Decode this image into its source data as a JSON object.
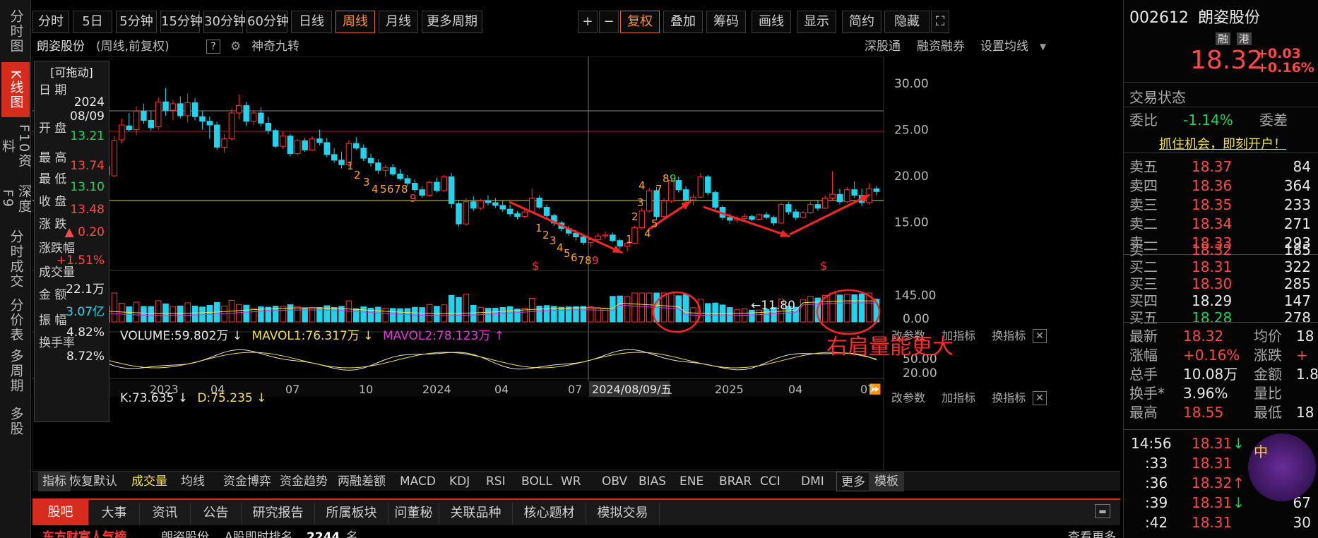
{
  "left_nav": [
    "分时图",
    "K线图",
    "F10资料",
    "深度F9",
    "分时成交",
    "分价表",
    "多周期",
    "多股"
  ],
  "left_nav_active": 1,
  "toolbar": {
    "periods": [
      "分时",
      "5日",
      "5分钟",
      "15分钟",
      "30分钟",
      "60分钟",
      "日线",
      "周线",
      "月线",
      "更多周期"
    ],
    "selected_period": "周线",
    "right_buttons": [
      "+",
      "−",
      "复权",
      "叠加",
      "筹码",
      "画线",
      "显示",
      "简约",
      "隐藏"
    ]
  },
  "chart_header": {
    "name": "朗姿股份",
    "desc": "(周线,前复权)",
    "help": "?",
    "magic": "神奇九转",
    "links": [
      "深股通",
      "融资融券",
      "设置均线"
    ]
  },
  "data_window": {
    "drag_label": "[可拖动]",
    "rows": [
      {
        "label": "日 期",
        "value": "2024\n08/09",
        "color": "white"
      },
      {
        "label": "开 盘",
        "value": "13.21",
        "color": "green"
      },
      {
        "label": "最 高",
        "value": "13.74",
        "color": "red"
      },
      {
        "label": "最 低",
        "value": "13.10",
        "color": "green"
      },
      {
        "label": "收 盘",
        "value": "13.48",
        "color": "red"
      },
      {
        "label": "涨 跌",
        "value": "▲ 0.20",
        "color": "red"
      },
      {
        "label": "涨跌幅",
        "value": "+1.51%",
        "color": "red"
      },
      {
        "label": "成交量",
        "value": "22.1万",
        "color": "white"
      },
      {
        "label": "金 额",
        "value": "3.07亿",
        "color": "cyan"
      },
      {
        "label": "振 幅",
        "value": "4.82%",
        "color": "white"
      },
      {
        "label": "换手率",
        "value": "8.72%",
        "color": "white"
      }
    ]
  },
  "price_axis": [
    "30.00",
    "25.00",
    "20.00",
    "15.00"
  ],
  "volume_indicator": {
    "text": "VOLUME:59.802万 ↓",
    "mavol1": "MAVOL1:76.317万 ↓",
    "mavol2": "MAVOL2:78.123万 ↑",
    "links": [
      "改参数",
      "加指标",
      "换指标"
    ],
    "axis": [
      "145.00",
      "0.00"
    ]
  },
  "kdj_indicator": {
    "k": "K:73.635 ↓",
    "d": "D:75.235 ↓",
    "links": [
      "改参数",
      "加指标",
      "换指标"
    ],
    "axis": [
      "50.00",
      "20.00"
    ]
  },
  "annotations": {
    "low_price": "←11.80",
    "volume_note": "右肩量能更大",
    "td_counts_1": [
      "1",
      "2",
      "3",
      "4",
      "5",
      "6",
      "7",
      "8",
      "9"
    ],
    "td_top": [
      "4",
      "7",
      "8",
      "9"
    ]
  },
  "x_axis": [
    "10",
    "2023",
    "04",
    "07",
    "10",
    "2024",
    "04",
    "07",
    "2024/08/09/五",
    "2025",
    "04",
    "07"
  ],
  "bottom_tabs": [
    "指标",
    "恢复默认",
    "成交量",
    "均线",
    "资金博弈",
    "资金趋势",
    "两融差额",
    "MACD",
    "KDJ",
    "RSI",
    "BOLL",
    "WR",
    "OBV",
    "BIAS",
    "ENE",
    "BRAR",
    "CCI",
    "DMI",
    "更多",
    "模板"
  ],
  "info_tabs": [
    "股吧",
    "大事",
    "资讯",
    "公告",
    "研究报告",
    "所属板块",
    "问董秘",
    "关联品种",
    "核心题材",
    "模拟交易"
  ],
  "footer": {
    "left": "东方财富人气榜",
    "stock": "朗姿股份",
    "rank_label": "A股即时排名",
    "rank": "2244",
    "unit": "名",
    "more": "查看更多"
  },
  "quote": {
    "code": "002612",
    "name": "朗姿股份",
    "tags": [
      "融",
      "港"
    ],
    "price": "18.32",
    "change": "+0.03",
    "pct": "+0.16%",
    "status_label": "交易状态",
    "weibi_label": "委比",
    "weibi": "-1.14%",
    "weicha_label": "委差",
    "promo": "抓住机会，即刻开户！",
    "asks": [
      {
        "label": "卖五",
        "price": "18.37",
        "vol": "84"
      },
      {
        "label": "卖四",
        "price": "18.36",
        "vol": "364"
      },
      {
        "label": "卖三",
        "price": "18.35",
        "vol": "233"
      },
      {
        "label": "卖二",
        "price": "18.34",
        "vol": "271"
      },
      {
        "label": "卖一",
        "price": "18.33",
        "vol": "293"
      }
    ],
    "bids": [
      {
        "label": "买一",
        "price": "18.32",
        "vol": "185"
      },
      {
        "label": "买二",
        "price": "18.31",
        "vol": "322"
      },
      {
        "label": "买三",
        "price": "18.30",
        "vol": "285"
      },
      {
        "label": "买四",
        "price": "18.29",
        "vol": "147"
      },
      {
        "label": "买五",
        "price": "18.28",
        "vol": "278"
      }
    ],
    "stats": [
      {
        "l1": "最新",
        "v1": "18.32",
        "c1": "red",
        "l2": "均价",
        "v2": "18"
      },
      {
        "l1": "涨幅",
        "v1": "+0.16%",
        "c1": "red",
        "l2": "涨跌",
        "v2": "+"
      },
      {
        "l1": "总手",
        "v1": "10.08万",
        "c1": "white",
        "l2": "金额",
        "v2": "1.8"
      },
      {
        "l1": "换手*",
        "v1": "3.96%",
        "c1": "white",
        "l2": "量比",
        "v2": ""
      },
      {
        "l1": "最高",
        "v1": "18.55",
        "c1": "red",
        "l2": "最低",
        "v2": "18"
      }
    ],
    "ticks": [
      {
        "time": "14:56",
        "price": "18.31",
        "arrow": "↓",
        "vol": ""
      },
      {
        "time": ":33",
        "price": "18.31",
        "arrow": "",
        "vol": ""
      },
      {
        "time": ":36",
        "price": "18.32",
        "arrow": "↑",
        "vol": ""
      },
      {
        "time": ":39",
        "price": "18.31",
        "arrow": "↓",
        "vol": "67"
      },
      {
        "time": ":42",
        "price": "18.31",
        "arrow": "",
        "vol": "30"
      }
    ]
  },
  "chart_data": {
    "type": "candlestick",
    "ylim": [
      10,
      31
    ],
    "x_labels": [
      "10",
      "2023",
      "04",
      "07",
      "10",
      "2024",
      "04",
      "07",
      "2025",
      "04",
      "07"
    ],
    "ohlc_weekly": [
      [
        20.5,
        21.5,
        19.6,
        21.0
      ],
      [
        21.0,
        21.6,
        19.8,
        20.1
      ],
      [
        20.0,
        24.3,
        19.9,
        23.8
      ],
      [
        23.9,
        26.2,
        23.5,
        25.5
      ],
      [
        25.4,
        26.8,
        24.8,
        25.0
      ],
      [
        25.0,
        27.5,
        24.4,
        27.0
      ],
      [
        27.0,
        27.8,
        25.6,
        26.0
      ],
      [
        26.0,
        27.0,
        24.9,
        25.2
      ],
      [
        25.3,
        28.5,
        25.0,
        28.0
      ],
      [
        28.0,
        29.5,
        26.5,
        27.1
      ],
      [
        27.1,
        28.2,
        26.0,
        27.8
      ],
      [
        27.8,
        28.6,
        26.2,
        26.5
      ],
      [
        26.5,
        28.9,
        25.8,
        27.9
      ],
      [
        27.9,
        28.4,
        26.0,
        26.4
      ],
      [
        26.4,
        27.0,
        25.0,
        25.9
      ],
      [
        25.9,
        26.4,
        24.0,
        25.5
      ],
      [
        25.5,
        25.9,
        22.8,
        23.1
      ],
      [
        23.1,
        24.5,
        22.5,
        24.0
      ],
      [
        24.0,
        27.2,
        23.8,
        26.8
      ],
      [
        26.8,
        28.8,
        26.1,
        27.6
      ],
      [
        27.6,
        28.0,
        25.4,
        25.9
      ],
      [
        25.9,
        27.1,
        25.5,
        26.8
      ],
      [
        26.8,
        27.4,
        25.3,
        25.7
      ],
      [
        25.7,
        26.4,
        24.5,
        24.9
      ],
      [
        24.9,
        25.1,
        23.0,
        23.2
      ],
      [
        23.2,
        24.8,
        22.9,
        24.3
      ],
      [
        24.3,
        24.5,
        22.1,
        22.4
      ],
      [
        22.4,
        24.0,
        22.2,
        23.8
      ],
      [
        23.8,
        24.1,
        22.6,
        22.8
      ],
      [
        22.8,
        24.3,
        22.7,
        24.0
      ],
      [
        24.0,
        25.0,
        23.3,
        23.6
      ],
      [
        23.6,
        24.1,
        22.0,
        22.3
      ],
      [
        22.3,
        23.0,
        21.4,
        21.7
      ],
      [
        21.7,
        22.6,
        20.8,
        21.2
      ],
      [
        21.2,
        23.9,
        21.0,
        23.5
      ],
      [
        23.5,
        24.2,
        22.8,
        23.0
      ],
      [
        23.0,
        23.4,
        21.6,
        21.9
      ],
      [
        21.9,
        22.4,
        21.0,
        21.4
      ],
      [
        21.4,
        21.8,
        20.2,
        20.6
      ],
      [
        20.6,
        21.2,
        19.9,
        20.9
      ],
      [
        20.9,
        21.3,
        20.0,
        20.2
      ],
      [
        20.2,
        20.7,
        19.5,
        19.7
      ],
      [
        19.7,
        20.1,
        18.9,
        19.2
      ],
      [
        19.2,
        19.6,
        18.2,
        18.5
      ],
      [
        18.5,
        18.9,
        17.6,
        17.9
      ],
      [
        17.9,
        19.5,
        17.7,
        19.3
      ],
      [
        19.3,
        19.8,
        18.2,
        18.4
      ],
      [
        18.4,
        20.1,
        18.3,
        19.9
      ],
      [
        19.9,
        20.3,
        16.5,
        17.0
      ],
      [
        17.0,
        17.4,
        14.5,
        14.8
      ],
      [
        14.8,
        17.6,
        14.6,
        17.2
      ],
      [
        17.2,
        17.8,
        16.2,
        16.5
      ],
      [
        16.5,
        17.5,
        16.3,
        17.3
      ],
      [
        17.3,
        17.9,
        16.8,
        17.1
      ],
      [
        17.1,
        17.6,
        16.5,
        16.8
      ],
      [
        16.8,
        17.3,
        16.1,
        16.4
      ],
      [
        16.4,
        16.9,
        15.6,
        15.9
      ],
      [
        15.9,
        16.2,
        15.3,
        15.6
      ],
      [
        15.6,
        16.4,
        15.4,
        16.1
      ],
      [
        16.1,
        18.6,
        16.0,
        17.6
      ],
      [
        17.6,
        17.9,
        16.4,
        16.6
      ],
      [
        16.6,
        16.9,
        15.4,
        15.7
      ],
      [
        15.7,
        15.9,
        14.6,
        14.9
      ],
      [
        14.9,
        15.1,
        14.0,
        14.3
      ],
      [
        14.3,
        14.6,
        13.5,
        13.8
      ],
      [
        13.8,
        14.1,
        13.0,
        13.4
      ],
      [
        13.4,
        13.6,
        12.5,
        12.8
      ],
      [
        12.8,
        13.3,
        12.3,
        13.1
      ],
      [
        13.1,
        13.8,
        12.9,
        13.5
      ],
      [
        13.5,
        14.0,
        13.2,
        13.6
      ],
      [
        13.6,
        13.9,
        12.8,
        13.0
      ],
      [
        13.0,
        13.2,
        12.1,
        12.4
      ],
      [
        12.4,
        12.8,
        11.8,
        12.7
      ],
      [
        12.7,
        14.6,
        12.6,
        14.4
      ],
      [
        14.4,
        16.5,
        14.2,
        16.2
      ],
      [
        16.2,
        18.7,
        16.0,
        18.4
      ],
      [
        18.4,
        18.8,
        15.2,
        15.6
      ],
      [
        15.6,
        17.6,
        15.4,
        17.3
      ],
      [
        17.3,
        19.8,
        17.1,
        19.5
      ],
      [
        19.5,
        19.9,
        18.2,
        18.5
      ],
      [
        18.5,
        18.9,
        17.1,
        17.4
      ],
      [
        17.4,
        18.0,
        16.8,
        17.7
      ],
      [
        17.7,
        20.3,
        17.6,
        19.9
      ],
      [
        19.9,
        20.1,
        17.9,
        18.2
      ],
      [
        18.2,
        18.4,
        16.3,
        16.6
      ],
      [
        16.6,
        16.8,
        15.2,
        15.5
      ],
      [
        15.5,
        15.9,
        14.8,
        15.2
      ],
      [
        15.2,
        15.7,
        14.9,
        15.4
      ],
      [
        15.4,
        15.9,
        15.0,
        15.6
      ],
      [
        15.6,
        15.8,
        15.1,
        15.3
      ],
      [
        15.3,
        15.9,
        15.2,
        15.8
      ],
      [
        15.8,
        16.1,
        15.3,
        15.5
      ],
      [
        15.5,
        15.7,
        14.6,
        14.9
      ],
      [
        14.9,
        17.1,
        14.8,
        16.9
      ],
      [
        16.9,
        17.2,
        15.8,
        16.1
      ],
      [
        16.1,
        16.4,
        15.2,
        15.5
      ],
      [
        15.5,
        16.2,
        15.4,
        16.0
      ],
      [
        16.0,
        17.2,
        15.9,
        16.9
      ],
      [
        16.9,
        17.3,
        16.2,
        16.5
      ],
      [
        16.5,
        17.9,
        16.4,
        17.6
      ],
      [
        17.6,
        20.5,
        17.4,
        18.0
      ],
      [
        18.0,
        18.6,
        16.9,
        17.2
      ],
      [
        17.2,
        18.8,
        17.0,
        18.5
      ],
      [
        18.5,
        19.4,
        17.6,
        17.9
      ],
      [
        17.9,
        18.6,
        16.7,
        17.1
      ],
      [
        17.1,
        19.2,
        16.9,
        18.6
      ],
      [
        18.6,
        18.9,
        17.9,
        18.3
      ]
    ]
  }
}
